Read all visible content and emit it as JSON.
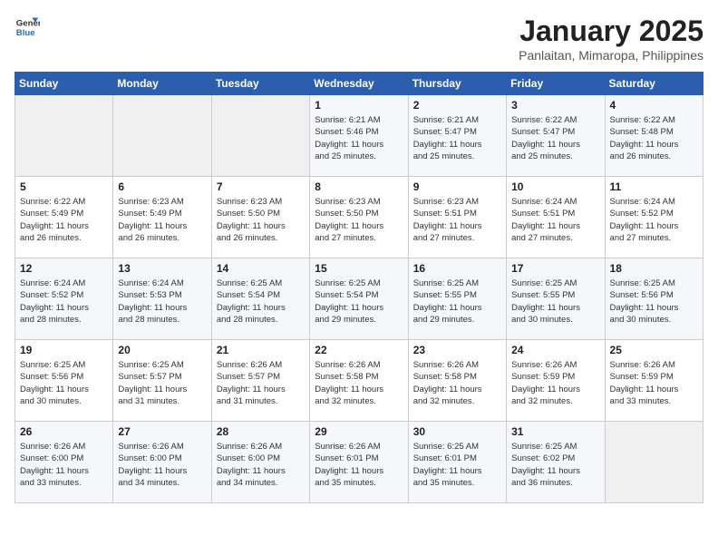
{
  "header": {
    "logo_line1": "General",
    "logo_line2": "Blue",
    "month_title": "January 2025",
    "location": "Panlaitan, Mimaropa, Philippines"
  },
  "weekdays": [
    "Sunday",
    "Monday",
    "Tuesday",
    "Wednesday",
    "Thursday",
    "Friday",
    "Saturday"
  ],
  "weeks": [
    [
      {
        "day": "",
        "info": ""
      },
      {
        "day": "",
        "info": ""
      },
      {
        "day": "",
        "info": ""
      },
      {
        "day": "1",
        "info": "Sunrise: 6:21 AM\nSunset: 5:46 PM\nDaylight: 11 hours\nand 25 minutes."
      },
      {
        "day": "2",
        "info": "Sunrise: 6:21 AM\nSunset: 5:47 PM\nDaylight: 11 hours\nand 25 minutes."
      },
      {
        "day": "3",
        "info": "Sunrise: 6:22 AM\nSunset: 5:47 PM\nDaylight: 11 hours\nand 25 minutes."
      },
      {
        "day": "4",
        "info": "Sunrise: 6:22 AM\nSunset: 5:48 PM\nDaylight: 11 hours\nand 26 minutes."
      }
    ],
    [
      {
        "day": "5",
        "info": "Sunrise: 6:22 AM\nSunset: 5:49 PM\nDaylight: 11 hours\nand 26 minutes."
      },
      {
        "day": "6",
        "info": "Sunrise: 6:23 AM\nSunset: 5:49 PM\nDaylight: 11 hours\nand 26 minutes."
      },
      {
        "day": "7",
        "info": "Sunrise: 6:23 AM\nSunset: 5:50 PM\nDaylight: 11 hours\nand 26 minutes."
      },
      {
        "day": "8",
        "info": "Sunrise: 6:23 AM\nSunset: 5:50 PM\nDaylight: 11 hours\nand 27 minutes."
      },
      {
        "day": "9",
        "info": "Sunrise: 6:23 AM\nSunset: 5:51 PM\nDaylight: 11 hours\nand 27 minutes."
      },
      {
        "day": "10",
        "info": "Sunrise: 6:24 AM\nSunset: 5:51 PM\nDaylight: 11 hours\nand 27 minutes."
      },
      {
        "day": "11",
        "info": "Sunrise: 6:24 AM\nSunset: 5:52 PM\nDaylight: 11 hours\nand 27 minutes."
      }
    ],
    [
      {
        "day": "12",
        "info": "Sunrise: 6:24 AM\nSunset: 5:52 PM\nDaylight: 11 hours\nand 28 minutes."
      },
      {
        "day": "13",
        "info": "Sunrise: 6:24 AM\nSunset: 5:53 PM\nDaylight: 11 hours\nand 28 minutes."
      },
      {
        "day": "14",
        "info": "Sunrise: 6:25 AM\nSunset: 5:54 PM\nDaylight: 11 hours\nand 28 minutes."
      },
      {
        "day": "15",
        "info": "Sunrise: 6:25 AM\nSunset: 5:54 PM\nDaylight: 11 hours\nand 29 minutes."
      },
      {
        "day": "16",
        "info": "Sunrise: 6:25 AM\nSunset: 5:55 PM\nDaylight: 11 hours\nand 29 minutes."
      },
      {
        "day": "17",
        "info": "Sunrise: 6:25 AM\nSunset: 5:55 PM\nDaylight: 11 hours\nand 30 minutes."
      },
      {
        "day": "18",
        "info": "Sunrise: 6:25 AM\nSunset: 5:56 PM\nDaylight: 11 hours\nand 30 minutes."
      }
    ],
    [
      {
        "day": "19",
        "info": "Sunrise: 6:25 AM\nSunset: 5:56 PM\nDaylight: 11 hours\nand 30 minutes."
      },
      {
        "day": "20",
        "info": "Sunrise: 6:25 AM\nSunset: 5:57 PM\nDaylight: 11 hours\nand 31 minutes."
      },
      {
        "day": "21",
        "info": "Sunrise: 6:26 AM\nSunset: 5:57 PM\nDaylight: 11 hours\nand 31 minutes."
      },
      {
        "day": "22",
        "info": "Sunrise: 6:26 AM\nSunset: 5:58 PM\nDaylight: 11 hours\nand 32 minutes."
      },
      {
        "day": "23",
        "info": "Sunrise: 6:26 AM\nSunset: 5:58 PM\nDaylight: 11 hours\nand 32 minutes."
      },
      {
        "day": "24",
        "info": "Sunrise: 6:26 AM\nSunset: 5:59 PM\nDaylight: 11 hours\nand 32 minutes."
      },
      {
        "day": "25",
        "info": "Sunrise: 6:26 AM\nSunset: 5:59 PM\nDaylight: 11 hours\nand 33 minutes."
      }
    ],
    [
      {
        "day": "26",
        "info": "Sunrise: 6:26 AM\nSunset: 6:00 PM\nDaylight: 11 hours\nand 33 minutes."
      },
      {
        "day": "27",
        "info": "Sunrise: 6:26 AM\nSunset: 6:00 PM\nDaylight: 11 hours\nand 34 minutes."
      },
      {
        "day": "28",
        "info": "Sunrise: 6:26 AM\nSunset: 6:00 PM\nDaylight: 11 hours\nand 34 minutes."
      },
      {
        "day": "29",
        "info": "Sunrise: 6:26 AM\nSunset: 6:01 PM\nDaylight: 11 hours\nand 35 minutes."
      },
      {
        "day": "30",
        "info": "Sunrise: 6:25 AM\nSunset: 6:01 PM\nDaylight: 11 hours\nand 35 minutes."
      },
      {
        "day": "31",
        "info": "Sunrise: 6:25 AM\nSunset: 6:02 PM\nDaylight: 11 hours\nand 36 minutes."
      },
      {
        "day": "",
        "info": ""
      }
    ]
  ]
}
